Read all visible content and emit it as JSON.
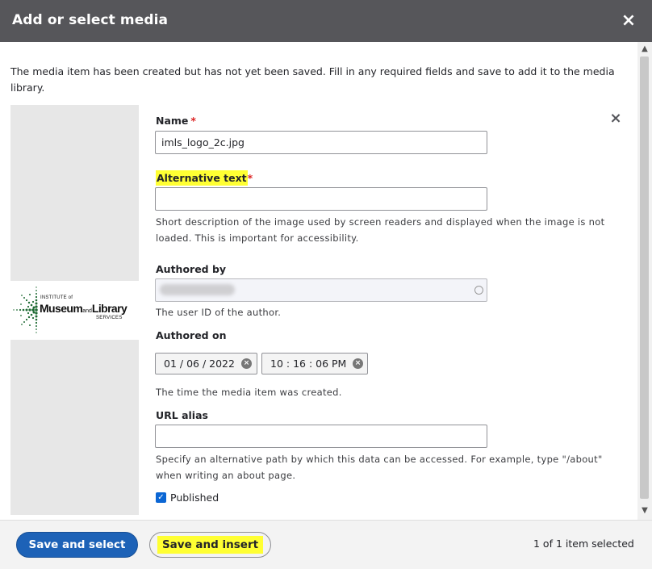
{
  "dialog": {
    "title": "Add or select media",
    "close_label": "×"
  },
  "notice": "The media item has been created but has not yet been saved. Fill in any required fields and save to add it to the media library.",
  "preview": {
    "logo_line1": "INSTITUTE of",
    "logo_museum": "Museum",
    "logo_and": "and",
    "logo_library": "Library",
    "logo_services": "SERVICES",
    "remove_label": "×"
  },
  "form": {
    "name": {
      "label": "Name",
      "required_mark": "*",
      "value": "imls_logo_2c.jpg"
    },
    "alt_text": {
      "label": "Alternative text",
      "required_mark": "*",
      "value": "",
      "description": "Short description of the image used by screen readers and displayed when the image is not loaded. This is important for accessibility."
    },
    "authored_by": {
      "label": "Authored by",
      "description": "The user ID of the author."
    },
    "authored_on": {
      "label": "Authored on",
      "date": "01 / 06 / 2022",
      "time": "10 : 16 : 06  PM",
      "description": "The time the media item was created."
    },
    "url_alias": {
      "label": "URL alias",
      "value": "",
      "description": "Specify an alternative path by which this data can be accessed. For example, type \"/about\" when writing an about page."
    },
    "published": {
      "label": "Published",
      "checked": true
    }
  },
  "footer": {
    "save_select": "Save and select",
    "save_insert": "Save and insert",
    "selected_count": "1 of 1 item selected"
  },
  "colors": {
    "titlebar": "#56565a",
    "primary_button": "#1d62b7",
    "highlight": "#ffff33",
    "required": "#dc2323"
  }
}
